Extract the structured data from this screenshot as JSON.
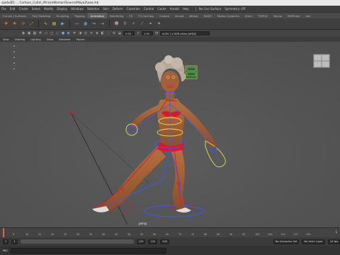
{
  "window": {
    "title": "ojada3D\\ ... Cartoon_Cutie\\_AfricanWoman\\Source\\Maya2\\aaa.mb"
  },
  "menu": {
    "items": [
      "File",
      "Edit",
      "Create",
      "Select",
      "Modify",
      "Display",
      "Windows",
      "Skeleton",
      "Skin",
      "Deform",
      "Constrain",
      "Control",
      "Cache",
      "Arnold",
      "Help"
    ],
    "surfaces_label": "No Live Surface",
    "symmetry_label": "Symmetry: Off"
  },
  "shelf_tabs": {
    "items": [
      "Curves / Surfaces",
      "Poly Modeling",
      "Sculpting",
      "Rigging",
      "Animation",
      "Rendering",
      "FX",
      "FX Caching",
      "Custom",
      "Arnold",
      "Bifrost",
      "MASH",
      "Motion Graphics",
      "XGen",
      "TURTLE",
      "Bonus",
      "MGPicker",
      "bull"
    ],
    "active_index": 4
  },
  "panel": {
    "menu": [
      "View",
      "Shading",
      "Lighting",
      "Show",
      "Renderer",
      "Panels"
    ],
    "gamma_value": "0.00",
    "exposure_value": "1.00",
    "colorspace": "ACES 1.0 SDR-video (sRGB)"
  },
  "viewport": {
    "camera_label": "persp"
  },
  "timeline": {
    "ticks": [
      "5",
      "10",
      "15",
      "20",
      "25",
      "30",
      "35",
      "40",
      "45",
      "50",
      "55",
      "60",
      "65",
      "70",
      "75",
      "80",
      "85",
      "90",
      "95",
      "100",
      "105",
      "110",
      "115",
      "120"
    ],
    "current_frame": "1"
  },
  "range": {
    "start": "1",
    "start_inner": "1",
    "end_inner": "120",
    "end": "120",
    "end2": "200",
    "character_set": "No Character Set",
    "anim_layer": "No Anim Layer",
    "fps": "24 fps"
  },
  "command": {
    "lang": "MEL"
  },
  "colors": {
    "accent": "#5285a6",
    "ctrl_red": "#e3152a",
    "ctrl_blue": "#3a58ff",
    "ctrl_yellow": "#e6df52"
  }
}
